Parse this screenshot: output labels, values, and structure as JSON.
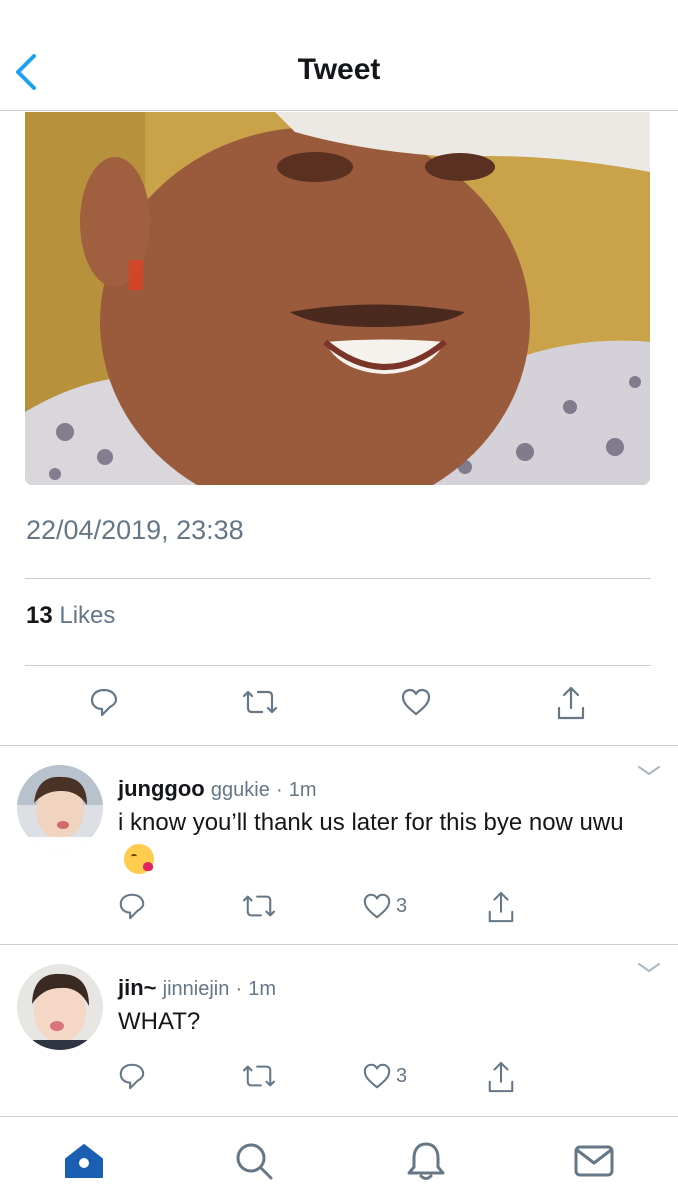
{
  "header": {
    "title": "Tweet",
    "back_icon": "chevron-left-icon"
  },
  "tweet": {
    "timestamp": "22/04/2019, 23:38",
    "likes_count": "13",
    "likes_label": "Likes"
  },
  "replies": [
    {
      "display_name": "junggoo",
      "handle": "ggukie",
      "dot": "·",
      "time": "1m",
      "text": "i know you’ll thank us later for this bye now uwu",
      "emoji": "face-blowing-a-kiss",
      "reply_count": "",
      "retweet_count": "",
      "like_count": "3"
    },
    {
      "display_name": "jin~",
      "handle": "jinniejin",
      "dot": "·",
      "time": "1m",
      "text": "WHAT?",
      "reply_count": "",
      "retweet_count": "",
      "like_count": "3"
    }
  ],
  "tabbar": {
    "items": [
      "home-icon",
      "search-icon",
      "notifications-icon",
      "messages-icon"
    ],
    "active": "home-icon"
  },
  "colors": {
    "accent": "#1da1f2",
    "active_tab": "#1b5fb3",
    "secondary_text": "#657786"
  }
}
